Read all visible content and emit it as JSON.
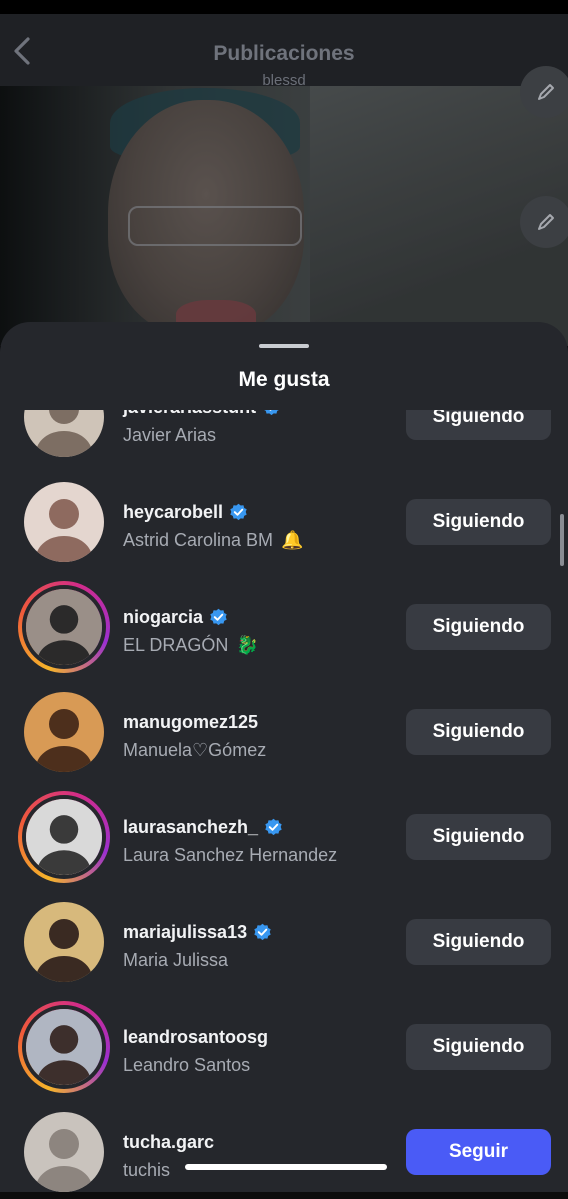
{
  "header": {
    "title": "Publicaciones",
    "subtitle": "blessd"
  },
  "sheet": {
    "title": "Me gusta"
  },
  "likes": [
    {
      "username": "javierariasstunt",
      "name": "Javier Arias",
      "verified": true,
      "button": "Siguiendo",
      "emoji": "",
      "ring": false
    },
    {
      "username": "heycarobell",
      "name": "Astrid Carolina BM",
      "verified": true,
      "button": "Siguiendo",
      "emoji": "🔔",
      "ring": false
    },
    {
      "username": "niogarcia",
      "name": "EL DRAGÓN",
      "verified": true,
      "button": "Siguiendo",
      "emoji": "🐉",
      "ring": true
    },
    {
      "username": "manugomez125",
      "name": "Manuela♡Gómez",
      "verified": false,
      "button": "Siguiendo",
      "emoji": "",
      "ring": false
    },
    {
      "username": "laurasanchezh_",
      "name": "Laura Sanchez Hernandez",
      "verified": true,
      "button": "Siguiendo",
      "emoji": "",
      "ring": true
    },
    {
      "username": "mariajulissa13",
      "name": "Maria Julissa",
      "verified": true,
      "button": "Siguiendo",
      "emoji": "",
      "ring": false
    },
    {
      "username": "leandrosantoosg",
      "name": "Leandro Santos",
      "verified": false,
      "button": "Siguiendo",
      "emoji": "",
      "ring": true
    },
    {
      "username": "tucha.garc",
      "name": "tuchis",
      "verified": false,
      "button": "Seguir",
      "emoji": "",
      "ring": false
    }
  ],
  "colors": {
    "accent": "#4a5bf6",
    "verified": "#3897f0",
    "sheet": "#25272c"
  },
  "icons": {
    "back": "chevron-left-icon",
    "edit": "pencil-icon",
    "verified": "verified-badge-icon"
  }
}
